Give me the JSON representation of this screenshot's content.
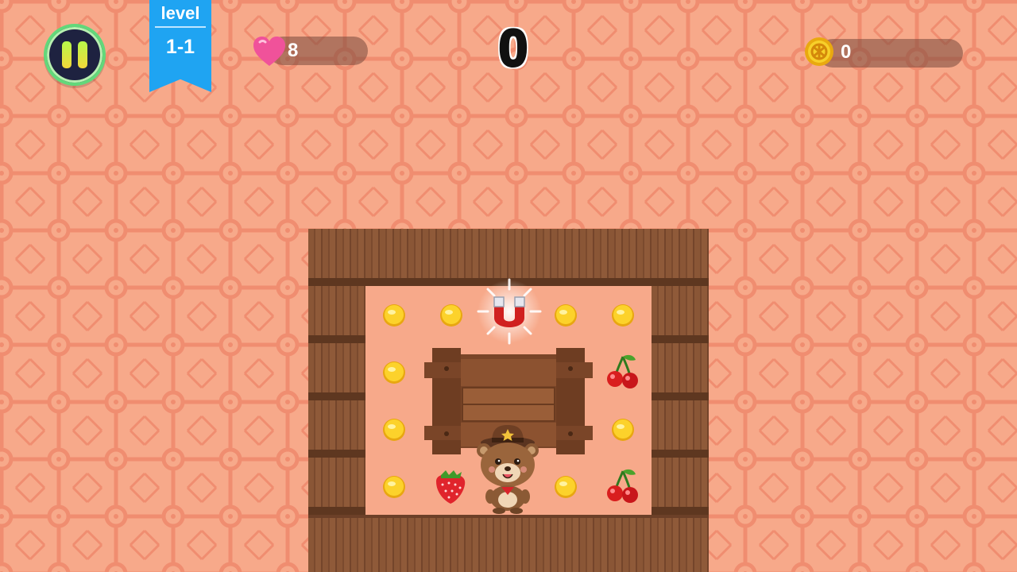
{
  "hud": {
    "pause_icon": "pause-icon",
    "level_label": "level",
    "level_value": "1-1",
    "hearts": "8",
    "score": "0",
    "coins": "0"
  },
  "colors": {
    "background": "#f7a98a",
    "wood": "#8a5636",
    "ribbon": "#1fa4f2",
    "pause_ring": "#62d87a",
    "coin": "#f5c21b",
    "heart": "#f0529a"
  },
  "board": {
    "items": [
      {
        "type": "coin",
        "icon": "coin-icon"
      },
      {
        "type": "coin",
        "icon": "coin-icon"
      },
      {
        "type": "magnet",
        "icon": "magnet-icon"
      },
      {
        "type": "coin",
        "icon": "coin-icon"
      },
      {
        "type": "coin",
        "icon": "coin-icon"
      },
      {
        "type": "coin",
        "icon": "coin-icon"
      },
      {
        "type": "cherry",
        "icon": "cherry-icon"
      },
      {
        "type": "coin",
        "icon": "coin-icon"
      },
      {
        "type": "coin",
        "icon": "coin-icon"
      },
      {
        "type": "coin",
        "icon": "coin-icon"
      },
      {
        "type": "strawberry",
        "icon": "strawberry-icon"
      },
      {
        "type": "coin",
        "icon": "coin-icon"
      },
      {
        "type": "cherry",
        "icon": "cherry-icon"
      }
    ],
    "player": "bear-sheriff-icon"
  }
}
